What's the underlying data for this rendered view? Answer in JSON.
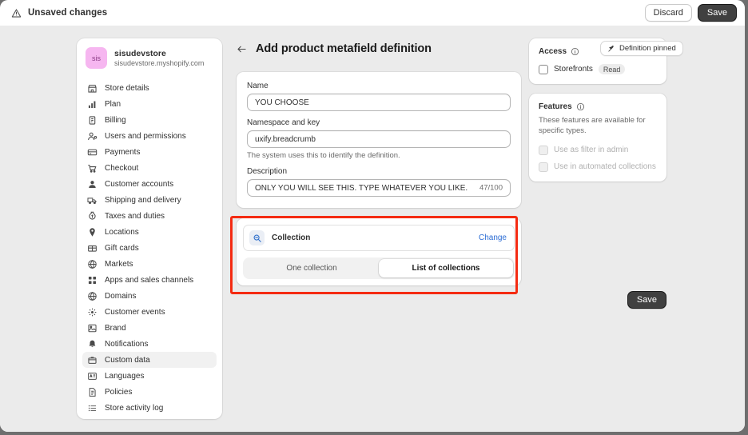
{
  "topbar": {
    "warning_icon": "warning-triangle-icon",
    "title": "Unsaved changes",
    "discard_label": "Discard",
    "save_label": "Save"
  },
  "sidebar": {
    "store": {
      "avatar_initials": "sis",
      "avatar_color": "#f6b6f0",
      "name": "sisudevstore",
      "domain": "sisudevstore.myshopify.com"
    },
    "items": [
      {
        "label": "Store details",
        "icon": "store-icon",
        "active": false
      },
      {
        "label": "Plan",
        "icon": "chart-bars-icon",
        "active": false
      },
      {
        "label": "Billing",
        "icon": "billing-icon",
        "active": false
      },
      {
        "label": "Users and permissions",
        "icon": "user-permissions-icon",
        "active": false
      },
      {
        "label": "Payments",
        "icon": "credit-card-icon",
        "active": false
      },
      {
        "label": "Checkout",
        "icon": "shopping-cart-icon",
        "active": false
      },
      {
        "label": "Customer accounts",
        "icon": "person-icon",
        "active": false
      },
      {
        "label": "Shipping and delivery",
        "icon": "delivery-truck-icon",
        "active": false
      },
      {
        "label": "Taxes and duties",
        "icon": "tax-icon",
        "active": false
      },
      {
        "label": "Locations",
        "icon": "map-pin-icon",
        "active": false
      },
      {
        "label": "Gift cards",
        "icon": "gift-card-icon",
        "active": false
      },
      {
        "label": "Markets",
        "icon": "globe-icon",
        "active": false
      },
      {
        "label": "Apps and sales channels",
        "icon": "apps-grid-icon",
        "active": false
      },
      {
        "label": "Domains",
        "icon": "globe-icon",
        "active": false
      },
      {
        "label": "Customer events",
        "icon": "events-icon",
        "active": false
      },
      {
        "label": "Brand",
        "icon": "brand-image-icon",
        "active": false
      },
      {
        "label": "Notifications",
        "icon": "bell-icon",
        "active": false
      },
      {
        "label": "Custom data",
        "icon": "database-icon",
        "active": true
      },
      {
        "label": "Languages",
        "icon": "languages-icon",
        "active": false
      },
      {
        "label": "Policies",
        "icon": "policies-icon",
        "active": false
      },
      {
        "label": "Store activity log",
        "icon": "list-icon",
        "active": false
      }
    ]
  },
  "main": {
    "back_icon": "back-arrow-icon",
    "title": "Add product metafield definition",
    "pinned_button": {
      "label": "Definition pinned",
      "icon": "pin-icon"
    },
    "form": {
      "name_label": "Name",
      "name_value": "YOU CHOOSE",
      "namespace_label": "Namespace and key",
      "namespace_value": "uxify.breadcrumb",
      "namespace_help": "The system uses this to identify the definition.",
      "description_label": "Description",
      "description_value": "ONLY YOU WILL SEE THIS. TYPE WHATEVER YOU LIKE.",
      "description_count": "47/100"
    },
    "type_card": {
      "icon": "collection-search-icon",
      "type_name": "Collection",
      "change_label": "Change",
      "segments": [
        {
          "label": "One collection",
          "selected": false
        },
        {
          "label": "List of collections",
          "selected": true
        }
      ]
    },
    "highlight_color": "#f42b12",
    "save_label": "Save"
  },
  "right": {
    "access": {
      "title": "Access",
      "info_icon": "info-circle-icon",
      "checkbox_label": "Storefronts",
      "checkbox_checked": false,
      "badge": "Read"
    },
    "features": {
      "title": "Features",
      "info_icon": "info-circle-icon",
      "description": "These features are available for specific types.",
      "options": [
        {
          "label": "Use as filter in admin",
          "disabled": true,
          "checked": false
        },
        {
          "label": "Use in automated collections",
          "disabled": true,
          "checked": false
        }
      ]
    }
  }
}
